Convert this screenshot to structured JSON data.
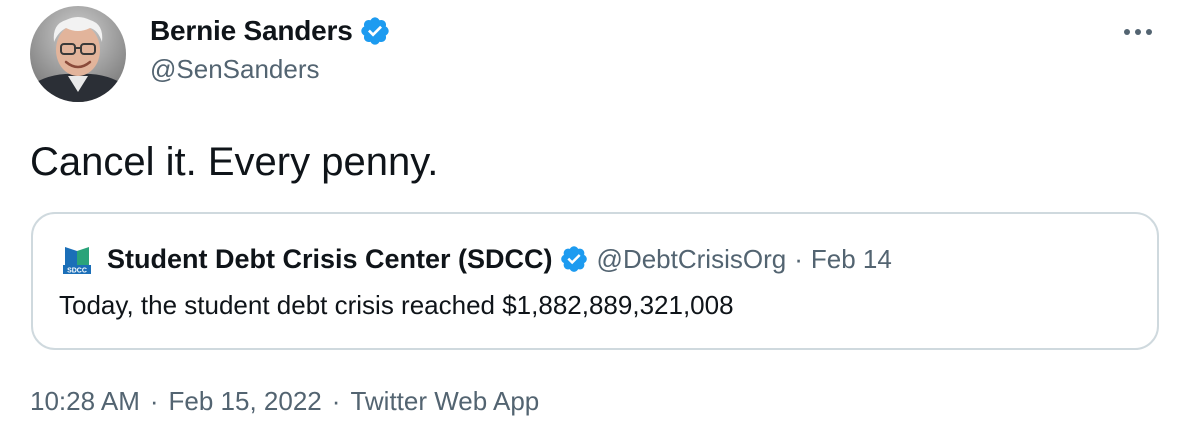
{
  "author": {
    "display_name": "Bernie Sanders",
    "handle": "@SenSanders",
    "verified": true,
    "avatar_icon": "avatar-photo"
  },
  "more_icon": "more-horizontal-icon",
  "tweet": {
    "text": "Cancel it. Every penny."
  },
  "quote": {
    "logo_icon": "sdcc-logo",
    "logo_text": "SDCC",
    "name": "Student Debt Crisis Center (SDCC)",
    "verified": true,
    "handle": "@DebtCrisisOrg",
    "separator": "·",
    "date": "Feb 14",
    "text": "Today, the student debt crisis reached $1,882,889,321,008"
  },
  "meta": {
    "time": "10:28 AM",
    "separator": "·",
    "date": "Feb 15, 2022",
    "source": "Twitter Web App"
  },
  "colors": {
    "verified_blue": "#1d9bf0",
    "text_primary": "#0f1419",
    "text_secondary": "#536471",
    "border": "#cfd9de"
  }
}
